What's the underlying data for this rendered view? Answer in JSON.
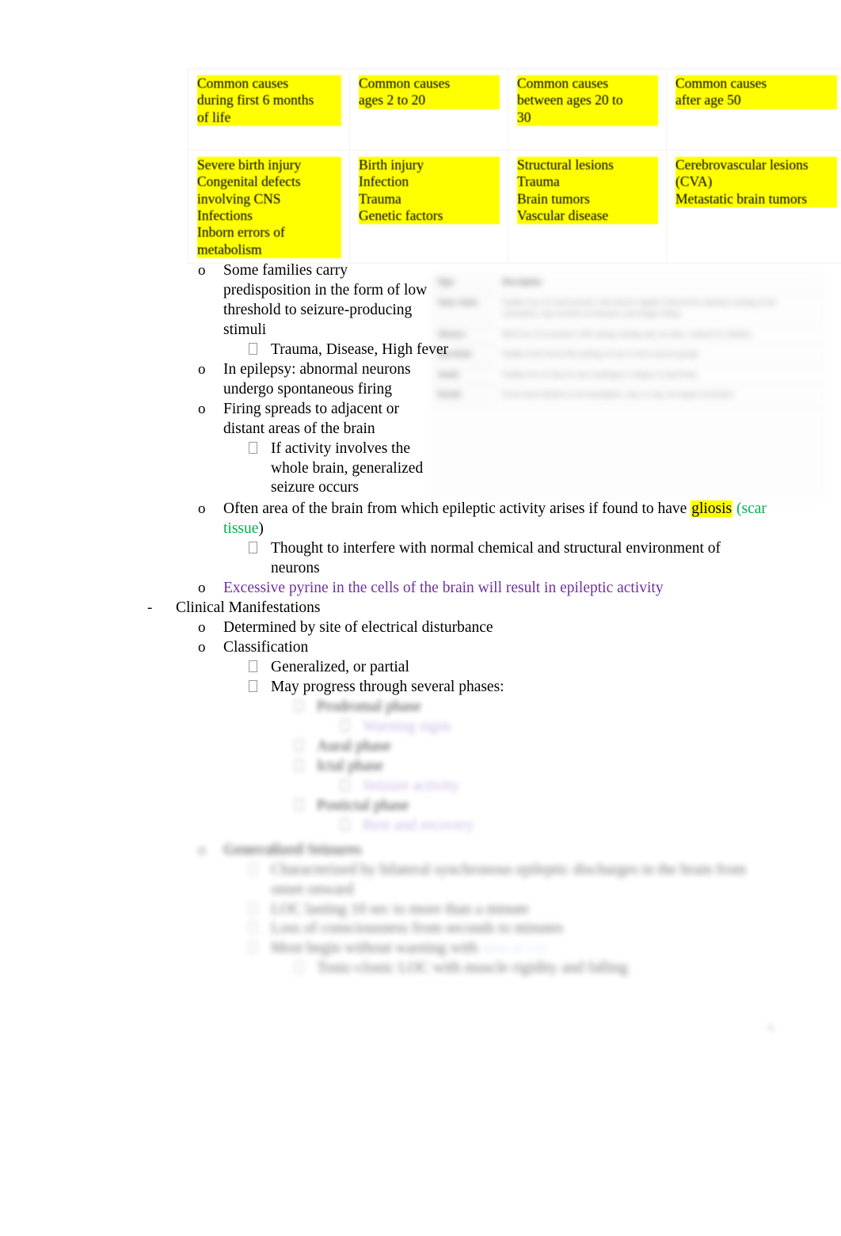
{
  "document": {
    "page_number": "6"
  },
  "causes_table": {
    "columns": [
      {
        "header_lines": [
          "Common causes",
          "during first 6 months",
          "of life"
        ],
        "body_lines": [
          "Severe birth injury",
          "Congenital defects",
          "involving CNS",
          "Infections",
          "Inborn errors of",
          "metabolism"
        ]
      },
      {
        "header_lines": [
          "Common causes",
          "ages 2 to 20"
        ],
        "body_lines": [
          "Birth injury",
          "Infection",
          "Trauma",
          "Genetic factors"
        ]
      },
      {
        "header_lines": [
          "Common causes",
          "between ages 20 to",
          "30"
        ],
        "body_lines": [
          "Structural lesions",
          "Trauma",
          "Brain tumors",
          "Vascular disease"
        ]
      },
      {
        "header_lines": [
          "Common causes",
          "after age 50"
        ],
        "body_lines": [
          "Cerebrovascular lesions",
          "(CVA)",
          "Metastatic brain tumors"
        ]
      }
    ]
  },
  "outline": {
    "item_families": "Some families carry predisposition in the form of low threshold to seizure-producing stimuli",
    "item_trauma": "Trauma, Disease, High fever",
    "item_epilepsy": "In epilepsy: abnormal neurons undergo spontaneous firing",
    "item_firing": "Firing spreads to adjacent or distant areas of the brain",
    "item_whole_brain": "If activity involves the whole brain, generalized seizure occurs",
    "item_gliosis_pre": "Often area of the brain from which epileptic activity arises if found to have ",
    "item_gliosis_word": "gliosis",
    "item_gliosis_scar": "(scar tissue",
    "item_gliosis_close": ")",
    "item_interfere": "Thought to interfere with normal chemical and structural environment of neurons",
    "item_pyrine": "Excessive pyrine in the cells of the brain will result in epileptic activity",
    "heading_clinical": "Clinical Manifestations",
    "item_determined": "Determined by site of electrical disturbance",
    "item_classification": "Classification",
    "item_generalized": "Generalized, or partial",
    "item_phases": "May progress through several phases:"
  },
  "markers": {
    "dash": "-",
    "circle": "o"
  },
  "inset_table": {
    "headers": [
      "Type",
      "Description"
    ],
    "rows": [
      [
        "Tonic-clonic",
        "Sudden loss of consciousness with muscle rigidity followed by rhythmic jerking of the extremities, may include incontinence and tongue biting"
      ],
      [
        "Absence",
        "Brief loss of awareness with staring, lasting only seconds, common in children"
      ],
      [
        "Myoclonic",
        "Sudden brief shock-like jerking of one or more muscle groups"
      ],
      [
        "Atonic",
        "Sudden loss of muscle tone resulting in collapse or head drop"
      ],
      [
        "Partial",
        "Focal onset limited to one hemisphere, may or may not impair awareness"
      ]
    ]
  },
  "blurred_lower": {
    "phase_prodromal": "Prodromal phase",
    "phase_prodromal_sub": "Warning signs",
    "phase_aural": "Aural phase",
    "phase_ictal": "Ictal phase",
    "phase_ictal_sub": "Seizure activity",
    "phase_postictal": "Postictal phase",
    "phase_postictal_sub": "Rest and recovery",
    "section_generalized": "Generalized Seizures",
    "gen_line1": "Characterized by bilateral synchronous epileptic discharges in the brain from onset onward",
    "gen_line2": "LOC lasting 10 sec to more than a minute",
    "gen_line3": "Loss of consciousness from seconds to minutes",
    "gen_line4": "Most begin without warning with",
    "gen_line4_hl": "aura or cry",
    "gen_line5": "Tonic-clonic LOC with muscle rigidity and falling"
  }
}
